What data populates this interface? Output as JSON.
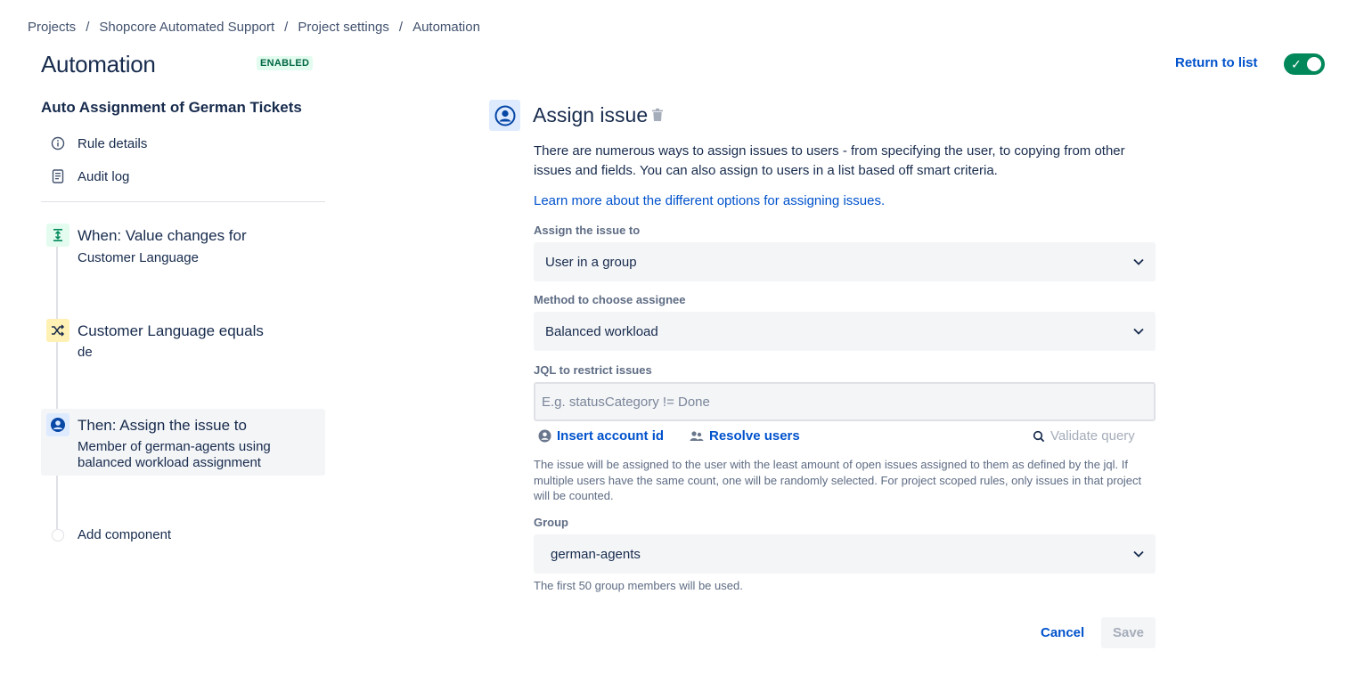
{
  "breadcrumb": [
    "Projects",
    "Shopcore Automated Support",
    "Project settings",
    "Automation"
  ],
  "breadcrumb_separator": "/",
  "page": {
    "title": "Automation",
    "badge": "ENABLED"
  },
  "header": {
    "return_label": "Return to list",
    "toggle_state": "on"
  },
  "sidebar": {
    "rule_name": "Auto Assignment of German Tickets",
    "links": [
      {
        "label": "Rule details",
        "icon": "info-icon"
      },
      {
        "label": "Audit log",
        "icon": "document-icon"
      }
    ],
    "components": [
      {
        "title": "When: Value changes for",
        "subtitle": "Customer Language",
        "icon": "trigger-icon",
        "color": "#e3fcef"
      },
      {
        "title": "Customer Language equals",
        "subtitle": "de",
        "icon": "condition-shuffle-icon",
        "color": "#fff0b3"
      },
      {
        "title": "Then: Assign the issue to",
        "subtitle_line1": "Member of german-agents using",
        "subtitle_line2": "balanced workload assignment",
        "icon": "user-avatar-icon",
        "color": "#deebff",
        "selected": true
      }
    ],
    "add_component": "Add component"
  },
  "panel": {
    "title": "Assign issue",
    "description": "There are numerous ways to assign issues to users - from specifying the user, to copying from other issues and fields. You can also assign to users in a list based off smart criteria.",
    "learn_more": "Learn more about the different options for assigning issues.",
    "assign_label": "Assign the issue to",
    "assign_value": "User in a group",
    "method_label": "Method to choose assignee",
    "method_value": "Balanced workload",
    "jql_label": "JQL to restrict issues",
    "jql_placeholder": "E.g. statusCategory != Done",
    "jql_value": "",
    "insert_account": "Insert account id",
    "resolve_users": "Resolve users",
    "validate_query": "Validate query",
    "method_help": "The issue will be assigned to the user with the least amount of open issues assigned to them as defined by the jql. If multiple users have the same count, one will be randomly selected. For project scoped rules, only issues in that project will be counted.",
    "group_label": "Group",
    "group_value": "german-agents",
    "group_help": "The first 50 group members will be used.",
    "cancel": "Cancel",
    "save": "Save"
  },
  "colors": {
    "link": "#0052cc",
    "toggle_on": "#00875a",
    "badge_bg": "#e3fcef",
    "badge_text": "#006644"
  }
}
